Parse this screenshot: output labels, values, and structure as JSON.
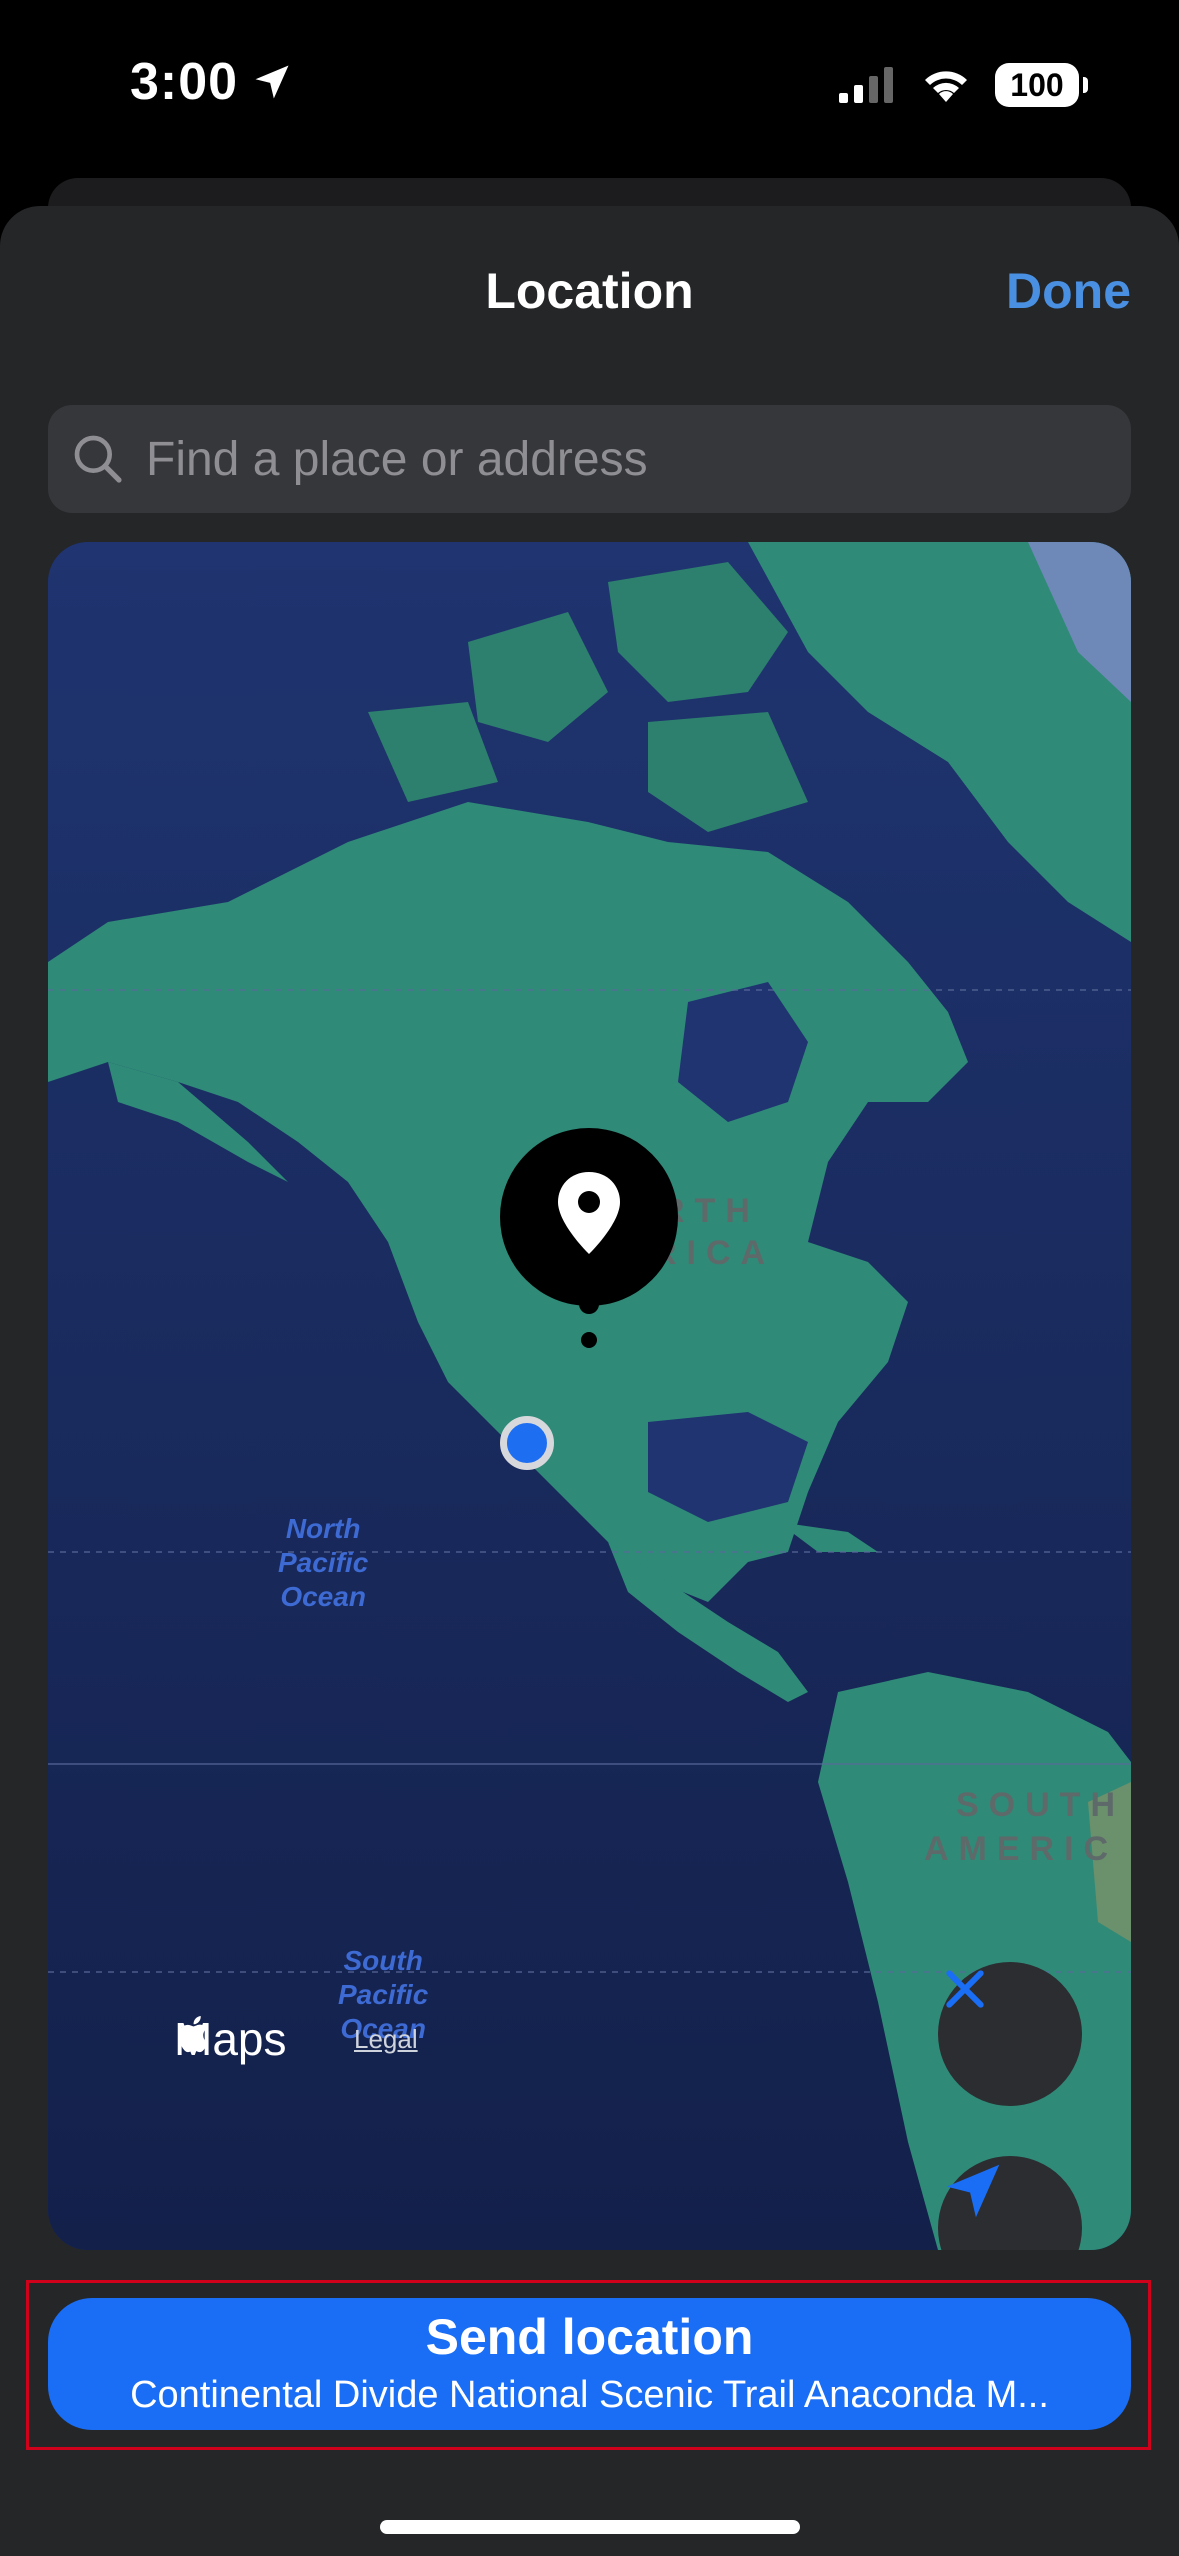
{
  "status_bar": {
    "time": "3:00",
    "battery": "100"
  },
  "header": {
    "title": "Location",
    "done_label": "Done"
  },
  "search": {
    "placeholder": "Find a place or address"
  },
  "map": {
    "continent_labels": [
      "RTH",
      "RICA",
      "SOUTH",
      "AMERIC"
    ],
    "ocean_labels": {
      "north_pacific": [
        "North",
        "Pacific",
        "Ocean"
      ],
      "south_pacific": [
        "South",
        "Pacific",
        "Ocean"
      ]
    },
    "maps_brand": "Maps",
    "legal": "Legal"
  },
  "send": {
    "title": "Send location",
    "subtitle": "Continental Divide National Scenic Trail Anaconda M..."
  },
  "colors": {
    "accent": "#1a6ef5",
    "done": "#4a90e2",
    "highlight": "#d0021b"
  }
}
